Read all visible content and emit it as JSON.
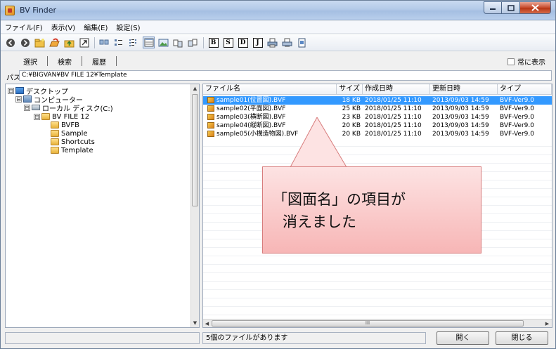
{
  "window": {
    "title": "BV Finder"
  },
  "menu": [
    "ファイル(F)",
    "表示(V)",
    "編集(E)",
    "設定(S)"
  ],
  "tabs": [
    "選択",
    "検索",
    "履歴"
  ],
  "always_on_top_label": "常に表示",
  "path": {
    "label": "パス",
    "value": "C:¥BIGVAN¥BV FILE 12¥Template"
  },
  "tree": {
    "nodes": [
      {
        "label": "デスクトップ",
        "toggle": "⊟",
        "icon": "monitor-icon"
      },
      {
        "label": "コンピューター",
        "toggle": "⊟",
        "icon": "computer-icon"
      },
      {
        "label": "ローカル ディスク(C:)",
        "toggle": "⊟",
        "icon": "drive-icon"
      },
      {
        "label": "BV FILE 12",
        "toggle": "⊟",
        "icon": "folder-icon"
      },
      {
        "label": "BVFB",
        "toggle": "",
        "icon": "folder-icon"
      },
      {
        "label": "Sample",
        "toggle": "",
        "icon": "folder-icon"
      },
      {
        "label": "Shortcuts",
        "toggle": "",
        "icon": "folder-icon"
      },
      {
        "label": "Template",
        "toggle": "",
        "icon": "folder-icon"
      }
    ]
  },
  "file_list": {
    "columns": [
      "ファイル名",
      "サイズ",
      "作成日時",
      "更新日時",
      "タイプ"
    ],
    "rows": [
      {
        "name": "sample01(位置図).BVF",
        "size": "18 KB",
        "created": "2018/01/25 11:10",
        "modified": "2013/09/03 14:59",
        "type": "BVF-Ver9.0",
        "selected": true
      },
      {
        "name": "sample02(平面図).BVF",
        "size": "25 KB",
        "created": "2018/01/25 11:10",
        "modified": "2013/09/03 14:59",
        "type": "BVF-Ver9.0",
        "selected": false
      },
      {
        "name": "sample03(横断図).BVF",
        "size": "23 KB",
        "created": "2018/01/25 11:10",
        "modified": "2013/09/03 14:59",
        "type": "BVF-Ver9.0",
        "selected": false
      },
      {
        "name": "sample04(縦断図).BVF",
        "size": "20 KB",
        "created": "2018/01/25 11:10",
        "modified": "2013/09/03 14:59",
        "type": "BVF-Ver9.0",
        "selected": false
      },
      {
        "name": "sample05(小構造物図).BVF",
        "size": "20 KB",
        "created": "2018/01/25 11:10",
        "modified": "2013/09/03 14:59",
        "type": "BVF-Ver9.0",
        "selected": false
      }
    ],
    "scroll_thumb_label": "III"
  },
  "callout": {
    "line1": "「図面名」の項目が",
    "line2": "消えました"
  },
  "status": {
    "file_count_text": "5個のファイルがあります"
  },
  "buttons": {
    "open": "開く",
    "close": "閉じる"
  },
  "colors": {
    "selection": "#3399ff",
    "callout_fill": "#f7b6b6",
    "titlebar": "#b3cae8"
  }
}
